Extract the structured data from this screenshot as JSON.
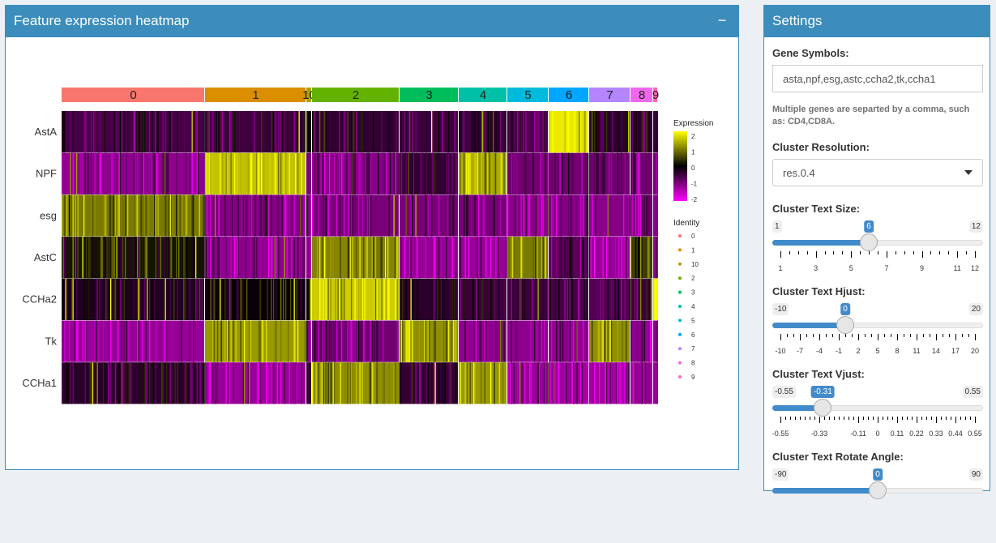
{
  "heatmap": {
    "title": "Feature expression heatmap",
    "collapse_label": "−",
    "clusters": [
      "0",
      "1",
      "10",
      "2",
      "3",
      "4",
      "5",
      "6",
      "7",
      "8",
      "9"
    ],
    "cluster_colors": [
      "#F8766D",
      "#DB8E00",
      "#AEA200",
      "#64B200",
      "#00BD5C",
      "#00C1A7",
      "#00BADE",
      "#00A6FF",
      "#B385FF",
      "#EF67EB",
      "#FF63B6"
    ],
    "genes": [
      "AstA",
      "NPF",
      "esg",
      "AstC",
      "CCHa2",
      "Tk",
      "CCHa1"
    ],
    "expr_mean": [
      [
        -0.7,
        -0.6,
        -0.1,
        -0.5,
        -0.6,
        -0.4,
        -0.8,
        2.3,
        -0.4,
        -0.4,
        -0.5
      ],
      [
        -1.4,
        1.9,
        -1.2,
        -1.3,
        -0.5,
        1.7,
        -1.1,
        -1.1,
        -1.1,
        -1.1,
        -1.1
      ],
      [
        1.2,
        -1.3,
        -1.2,
        -1.2,
        -1.2,
        -1.2,
        -1.3,
        -1.3,
        -1.3,
        -1.2,
        -1.3
      ],
      [
        0.2,
        -1.4,
        -1.4,
        1.3,
        -1.5,
        -1.5,
        1.2,
        -0.9,
        -1.5,
        0.6,
        -1.5
      ],
      [
        -0.3,
        -0.1,
        0.1,
        2.0,
        -0.4,
        -0.6,
        -0.6,
        -0.7,
        -0.8,
        -0.6,
        2.4
      ],
      [
        -1.5,
        1.5,
        -1.2,
        -1.1,
        1.4,
        -1.4,
        -1.4,
        -1.4,
        1.4,
        -1.4,
        -1.4
      ],
      [
        -0.4,
        -1.5,
        -0.5,
        1.4,
        -0.5,
        1.5,
        -1.5,
        -1.5,
        -1.6,
        -1.5,
        -1.5
      ]
    ],
    "legend_expression": {
      "title": "Expression",
      "ticks": [
        "2",
        "1",
        "0",
        "-1",
        "-2"
      ],
      "colors": [
        "#FF00FF",
        "#000000",
        "#FFFF00"
      ]
    },
    "legend_identity": {
      "title": "Identity",
      "items": [
        "0",
        "1",
        "10",
        "2",
        "3",
        "4",
        "5",
        "6",
        "7",
        "8",
        "9"
      ]
    }
  },
  "settings": {
    "title": "Settings",
    "gene_symbols_label": "Gene Symbols:",
    "gene_symbols_value": "asta,npf,esg,astc,ccha2,tk,ccha1",
    "help_text": "Multiple genes are separted by a comma, such as: CD4,CD8A.",
    "resolution_label": "Cluster Resolution:",
    "resolution_value": "res.0.4",
    "sliders": [
      {
        "label": "Cluster Text Size:",
        "min": 1,
        "max": 12,
        "value": 6,
        "min_label": "1",
        "max_label": "12",
        "value_label": "6",
        "tick_labels": [
          "1",
          "3",
          "5",
          "7",
          "9",
          "11",
          "12"
        ],
        "tick_values": [
          1,
          3,
          5,
          7,
          9,
          11,
          12
        ],
        "minor_step": 0.5
      },
      {
        "label": "Cluster Text Hjust:",
        "min": -10,
        "max": 20,
        "value": 0,
        "min_label": "-10",
        "max_label": "20",
        "value_label": "0",
        "tick_labels": [
          "-10",
          "-7",
          "-4",
          "-1",
          "2",
          "5",
          "8",
          "11",
          "14",
          "17",
          "20"
        ],
        "tick_values": [
          -10,
          -7,
          -4,
          -1,
          2,
          5,
          8,
          11,
          14,
          17,
          20
        ],
        "minor_step": 1
      },
      {
        "label": "Cluster Text Vjust:",
        "min": -0.55,
        "max": 0.55,
        "value": -0.31,
        "min_label": "-0.55",
        "max_label": "0.55",
        "value_label": "-0.31",
        "tick_labels": [
          "-0.55",
          "-0.33",
          "-0.11",
          "0",
          "0.11",
          "0.22",
          "0.33",
          "0.44",
          "0.55"
        ],
        "tick_values": [
          -0.55,
          -0.33,
          -0.11,
          0,
          0.11,
          0.22,
          0.33,
          0.44,
          0.55
        ],
        "minor_step": 0.0275
      },
      {
        "label": "Cluster Text Rotate Angle:",
        "min": -90,
        "max": 90,
        "value": 0,
        "min_label": "-90",
        "max_label": "90",
        "value_label": "0",
        "tick_labels": [],
        "tick_values": [],
        "minor_step": 10
      }
    ]
  }
}
